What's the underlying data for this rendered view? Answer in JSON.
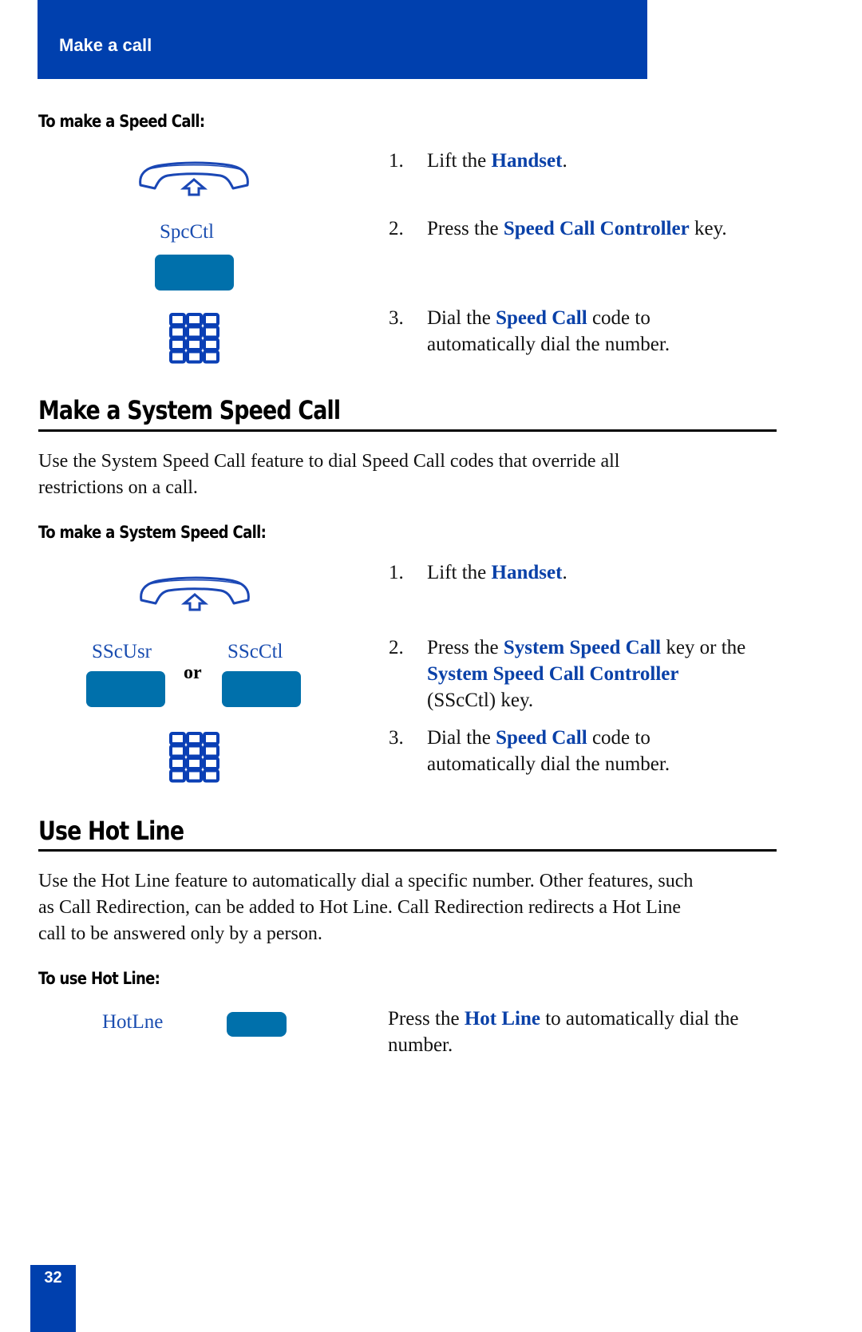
{
  "header": {
    "title": "Make a call",
    "color": "#0040ae"
  },
  "speed_call": {
    "subheading": "To make a Speed Call:",
    "key_label": "SpcCtl",
    "steps": [
      {
        "num": "1.",
        "pre": "Lift the ",
        "bold": "Handset",
        "post": "."
      },
      {
        "num": "2.",
        "pre": "Press the ",
        "bold": "Speed Call Controller",
        "post": " key."
      },
      {
        "num": "3.",
        "pre": "Dial the ",
        "bold": "Speed Call",
        "post": " code to",
        "line2": "automatically dial the number."
      }
    ]
  },
  "system_speed_call": {
    "heading": "Make a System Speed Call",
    "intro_line1": "Use the System Speed Call feature to dial Speed Call codes that override all",
    "intro_line2": "restrictions on a call.",
    "subheading": "To make a System Speed Call:",
    "key_label_left": "SScUsr",
    "key_label_right": "SScCtl",
    "or_label": "or",
    "steps": [
      {
        "num": "1.",
        "pre": "Lift the ",
        "bold": "Handset",
        "post": "."
      },
      {
        "num": "2.",
        "pre": "Press the ",
        "bold": "System Speed Call",
        "post": " key or the",
        "line2_bold": "System Speed Call Controller",
        "line3": "(SScCtl) key."
      },
      {
        "num": "3.",
        "pre": "Dial the ",
        "bold": "Speed Call",
        "post": " code to",
        "line2": "automatically dial the number."
      }
    ]
  },
  "hot_line": {
    "heading": "Use Hot Line",
    "intro_line1": "Use the Hot Line feature to automatically dial a specific number. Other features, such",
    "intro_line2": "as Call Redirection, can be added to Hot Line. Call Redirection redirects a Hot Line",
    "intro_line3": "call to be answered only by a person.",
    "subheading": "To use Hot Line:",
    "key_label": "HotLne",
    "instruction": {
      "pre": "Press the ",
      "bold": "Hot Line",
      "post": " to automatically dial the",
      "line2": "number."
    }
  },
  "footer": {
    "page_number": "32"
  },
  "colors": {
    "accent_blue": "#0040ae",
    "key_blue": "#0070ab",
    "highlight_text": "#0a41a8"
  }
}
